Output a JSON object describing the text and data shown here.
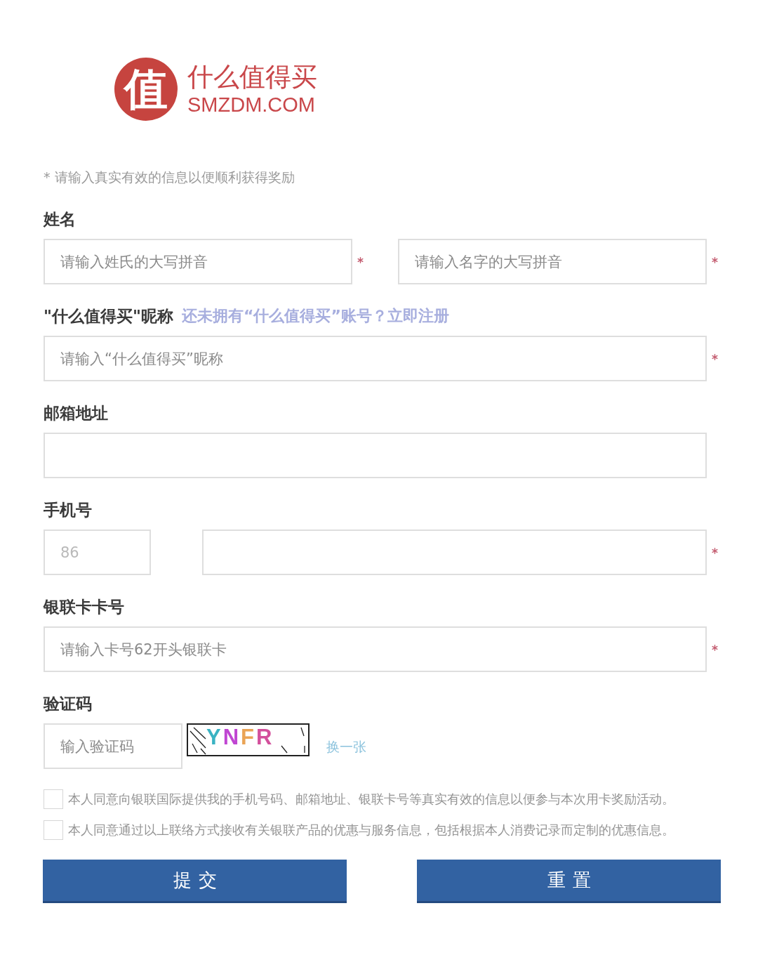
{
  "logo": {
    "mark": "值",
    "name": "什么值得买",
    "domain": "SMZDM.COM"
  },
  "notice": "* 请输入真实有效的信息以便顺利获得奖励",
  "fields": [
    {
      "kind": "pair",
      "label": "姓名",
      "inputs": [
        {
          "placeholder": "请输入姓氏的大写拼音",
          "required": true
        },
        {
          "placeholder": "请输入名字的大写拼音",
          "required": true
        }
      ]
    },
    {
      "kind": "single",
      "label": "\"什么值得买\"昵称",
      "link": "还未拥有“什么值得买”账号？立即注册",
      "inputs": [
        {
          "placeholder": "请输入“什么值得买”昵称",
          "required": true
        }
      ]
    },
    {
      "kind": "single",
      "label": "邮箱地址",
      "inputs": [
        {
          "required": false
        }
      ]
    },
    {
      "kind": "phone",
      "label": "手机号",
      "inputs": [
        {
          "value": "86",
          "required": false,
          "disabled": true
        },
        {
          "required": true
        }
      ]
    },
    {
      "kind": "single",
      "label": "银联卡卡号",
      "inputs": [
        {
          "placeholder": "请输入卡号62开头银联卡",
          "required": true
        }
      ]
    },
    {
      "kind": "captcha",
      "label": "验证码",
      "inputs": [
        {
          "placeholder": "输入验证码",
          "required": false
        }
      ],
      "captcha": {
        "code": "YNFR",
        "refresh": "换一张"
      }
    }
  ],
  "agreements": [
    {
      "text": "本人同意向银联国际提供我的手机号码、邮箱地址、银联卡号等真实有效的信息以便参与本次用卡奖励活动。",
      "checked": false
    },
    {
      "text": "本人同意通过以上联络方式接收有关银联产品的优惠与服务信息，包括根据本人消费记录而定制的优惠信息。",
      "checked": false
    }
  ],
  "buttons": [
    {
      "label": "提交"
    },
    {
      "label": "重置"
    }
  ]
}
